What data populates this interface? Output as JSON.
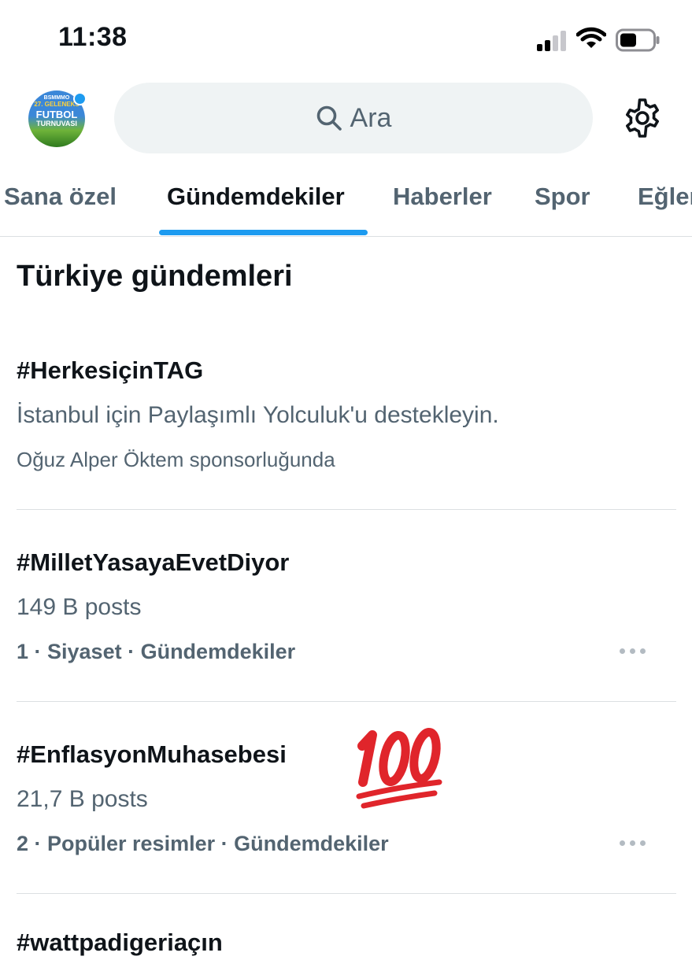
{
  "status_bar": {
    "time": "11:38"
  },
  "header": {
    "avatar_text": [
      "BSMMMO",
      "27. GELENEKS",
      "FUTBOL",
      "TURNUVASI"
    ],
    "search_placeholder": "Ara"
  },
  "tabs": [
    {
      "label": "Sana özel",
      "active": false
    },
    {
      "label": "Gündemdekiler",
      "active": true
    },
    {
      "label": "Haberler",
      "active": false
    },
    {
      "label": "Spor",
      "active": false
    },
    {
      "label": "Eğlen",
      "active": false
    }
  ],
  "section_title": "Türkiye gündemleri",
  "trends": [
    {
      "title": "#HerkesiçinTAG",
      "description": "İstanbul için Paylaşımlı Yolculuk'u destekleyin.",
      "sponsor": "Oğuz Alper Öktem sponsorluğunda"
    },
    {
      "title": "#MilletYasayaEvetDiyor",
      "posts": "149 B posts",
      "meta": "1 · Siyaset · Gündemdekiler"
    },
    {
      "title": "#EnflasyonMuhasebesi",
      "posts": "21,7 B posts",
      "meta": "2 · Popüler resimler · Gündemdekiler"
    },
    {
      "title": "#wattpadigeriaçın"
    }
  ],
  "colors": {
    "accent": "#1d9bf0",
    "secondary_text": "#536471",
    "search_bg": "#eff3f4",
    "emoji_red": "#e0252b"
  },
  "icons": [
    "signal-icon",
    "wifi-icon",
    "battery-icon",
    "search-icon",
    "gear-icon",
    "more-icon",
    "hundred-points-icon"
  ]
}
